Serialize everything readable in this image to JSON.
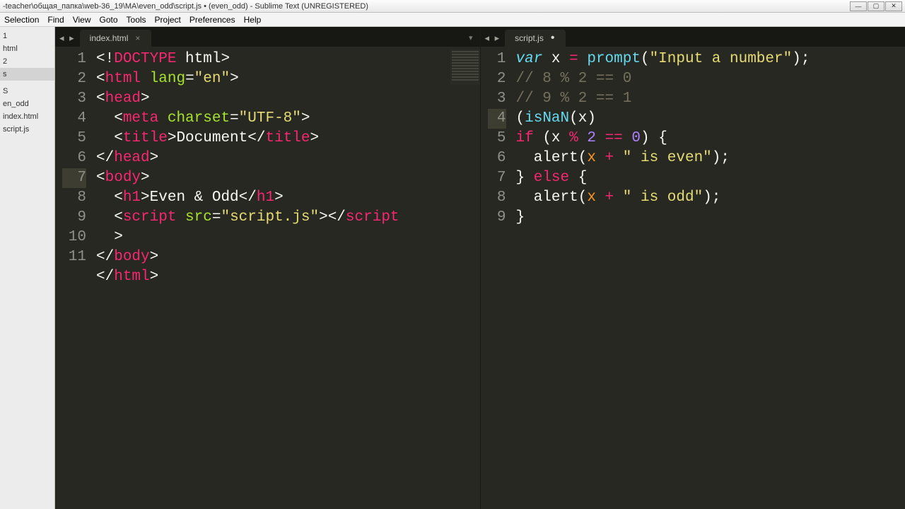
{
  "window": {
    "title": "-teacher\\общая_папка\\web-36_19\\MA\\even_odd\\script.js • (even_odd) - Sublime Text (UNREGISTERED)"
  },
  "menu": [
    "Selection",
    "Find",
    "View",
    "Goto",
    "Tools",
    "Project",
    "Preferences",
    "Help"
  ],
  "sidebar": {
    "items": [
      {
        "label": "1"
      },
      {
        "label": "html"
      },
      {
        "label": "2"
      },
      {
        "label": "s"
      },
      {
        "label": ""
      },
      {
        "label": "S"
      },
      {
        "label": "en_odd"
      },
      {
        "label": "index.html"
      },
      {
        "label": "script.js"
      }
    ],
    "active_index": 3
  },
  "panes": [
    {
      "nav": "◂ ▸",
      "tab": {
        "name": "index.html",
        "dirty": false,
        "close": "×"
      },
      "dropdown": "▾",
      "has_minimap": true,
      "gutter_wide": true,
      "lines": [
        {
          "n": 1,
          "hl": false,
          "tokens": [
            [
              "<!",
              "c-white"
            ],
            [
              "DOCTYPE",
              "c-pink"
            ],
            [
              " html",
              ""
            ],
            [
              ">",
              ""
            ]
          ]
        },
        {
          "n": 2,
          "hl": false,
          "tokens": [
            [
              "<",
              "c-white"
            ],
            [
              "html",
              "c-pink"
            ],
            [
              " ",
              ""
            ],
            [
              "lang",
              "c-green"
            ],
            [
              "=",
              "c-white"
            ],
            [
              "\"en\"",
              "c-yellow"
            ],
            [
              ">",
              ""
            ]
          ]
        },
        {
          "n": 3,
          "hl": false,
          "tokens": [
            [
              "<",
              "c-white"
            ],
            [
              "head",
              "c-pink"
            ],
            [
              ">",
              ""
            ]
          ]
        },
        {
          "n": 4,
          "hl": false,
          "tokens": [
            [
              "    ",
              "ind"
            ],
            [
              "<",
              "c-white"
            ],
            [
              "meta",
              "c-pink"
            ],
            [
              " ",
              ""
            ],
            [
              "charset",
              "c-green"
            ],
            [
              "=",
              "c-white"
            ],
            [
              "\"UTF-8\"",
              "c-yellow"
            ],
            [
              ">",
              ""
            ]
          ]
        },
        {
          "n": 5,
          "hl": false,
          "tokens": [
            [
              "    ",
              "ind"
            ],
            [
              "<",
              "c-white"
            ],
            [
              "title",
              "c-pink"
            ],
            [
              ">",
              "c-white"
            ],
            [
              "Document",
              "c-white"
            ],
            [
              "</",
              "c-white"
            ],
            [
              "title",
              "c-pink"
            ],
            [
              ">",
              ""
            ]
          ]
        },
        {
          "n": 6,
          "hl": false,
          "tokens": [
            [
              "</",
              "c-white"
            ],
            [
              "head",
              "c-pink"
            ],
            [
              ">",
              ""
            ]
          ]
        },
        {
          "n": 7,
          "hl": true,
          "tokens": [
            [
              "<",
              "c-white"
            ],
            [
              "body",
              "c-pink"
            ],
            [
              ">",
              ""
            ]
          ]
        },
        {
          "n": 8,
          "hl": false,
          "tokens": [
            [
              "    ",
              "ind"
            ],
            [
              "<",
              "c-white"
            ],
            [
              "h1",
              "c-pink"
            ],
            [
              ">",
              "c-white"
            ],
            [
              "Even & Odd",
              "c-white"
            ],
            [
              "</",
              "c-white"
            ],
            [
              "h1",
              "c-pink"
            ],
            [
              ">",
              ""
            ]
          ]
        },
        {
          "n": 9,
          "hl": false,
          "tokens": [
            [
              "    ",
              "ind"
            ],
            [
              "<",
              "c-white"
            ],
            [
              "script",
              "c-pink"
            ],
            [
              " ",
              ""
            ],
            [
              "src",
              "c-green"
            ],
            [
              "=",
              "c-white"
            ],
            [
              "\"script.js\"",
              "c-yellow"
            ],
            [
              ">",
              "c-white"
            ],
            [
              "</",
              "c-white"
            ],
            [
              "script",
              "c-pink"
            ]
          ]
        },
        {
          "n": "",
          "hl": false,
          "tokens": [
            [
              "    ",
              "ind"
            ],
            [
              ">",
              ""
            ]
          ]
        },
        {
          "n": 10,
          "hl": false,
          "tokens": [
            [
              "</",
              "c-white"
            ],
            [
              "body",
              "c-pink"
            ],
            [
              ">",
              ""
            ]
          ]
        },
        {
          "n": 11,
          "hl": false,
          "tokens": [
            [
              "</",
              "c-white"
            ],
            [
              "html",
              "c-pink"
            ],
            [
              ">",
              ""
            ]
          ]
        }
      ]
    },
    {
      "nav": "◂ ▸",
      "tab": {
        "name": "script.js",
        "dirty": true,
        "close": ""
      },
      "dropdown": "",
      "has_minimap": false,
      "gutter_wide": false,
      "lines": [
        {
          "n": 1,
          "hl": false,
          "tokens": [
            [
              "var",
              "c-blue"
            ],
            [
              " x ",
              "c-white"
            ],
            [
              "=",
              "c-pink"
            ],
            [
              " ",
              "c-white"
            ],
            [
              "prompt",
              "c-blue-n"
            ],
            [
              "(",
              "c-white"
            ],
            [
              "\"Input a number\"",
              "c-yellow"
            ],
            [
              ");",
              "c-white"
            ]
          ]
        },
        {
          "n": 2,
          "hl": false,
          "tokens": [
            [
              "// 8 % 2 == 0",
              "c-gray"
            ]
          ]
        },
        {
          "n": 3,
          "hl": false,
          "tokens": [
            [
              "// 9 % 2 == 1",
              "c-gray"
            ]
          ]
        },
        {
          "n": 4,
          "hl": true,
          "tokens": [
            [
              "(",
              "c-white"
            ],
            [
              "isNaN",
              "c-blue-n"
            ],
            [
              "(x)",
              "c-white"
            ]
          ]
        },
        {
          "n": 5,
          "hl": false,
          "tokens": [
            [
              "if",
              "c-pink"
            ],
            [
              " (x ",
              "c-white"
            ],
            [
              "%",
              "c-pink"
            ],
            [
              " ",
              "c-white"
            ],
            [
              "2",
              "c-purple"
            ],
            [
              " ",
              "c-white"
            ],
            [
              "==",
              "c-pink"
            ],
            [
              " ",
              "c-white"
            ],
            [
              "0",
              "c-purple"
            ],
            [
              ") {",
              "c-white"
            ]
          ]
        },
        {
          "n": 6,
          "hl": false,
          "tokens": [
            [
              "    ",
              "ind"
            ],
            [
              "alert(",
              "c-white"
            ],
            [
              "x",
              "c-orange"
            ],
            [
              " ",
              "c-white"
            ],
            [
              "+",
              "c-pink"
            ],
            [
              " ",
              "c-white"
            ],
            [
              "\" is even\"",
              "c-yellow"
            ],
            [
              ");",
              "c-white"
            ]
          ]
        },
        {
          "n": 7,
          "hl": false,
          "tokens": [
            [
              "} ",
              "c-white"
            ],
            [
              "else",
              "c-pink"
            ],
            [
              " {",
              "c-white"
            ]
          ]
        },
        {
          "n": 8,
          "hl": false,
          "tokens": [
            [
              "    ",
              "ind"
            ],
            [
              "alert(",
              "c-white"
            ],
            [
              "x",
              "c-orange"
            ],
            [
              " ",
              "c-white"
            ],
            [
              "+",
              "c-pink"
            ],
            [
              " ",
              "c-white"
            ],
            [
              "\" is odd\"",
              "c-yellow"
            ],
            [
              ");",
              "c-white"
            ]
          ]
        },
        {
          "n": 9,
          "hl": false,
          "tokens": [
            [
              "}",
              "c-white"
            ]
          ]
        }
      ]
    }
  ]
}
